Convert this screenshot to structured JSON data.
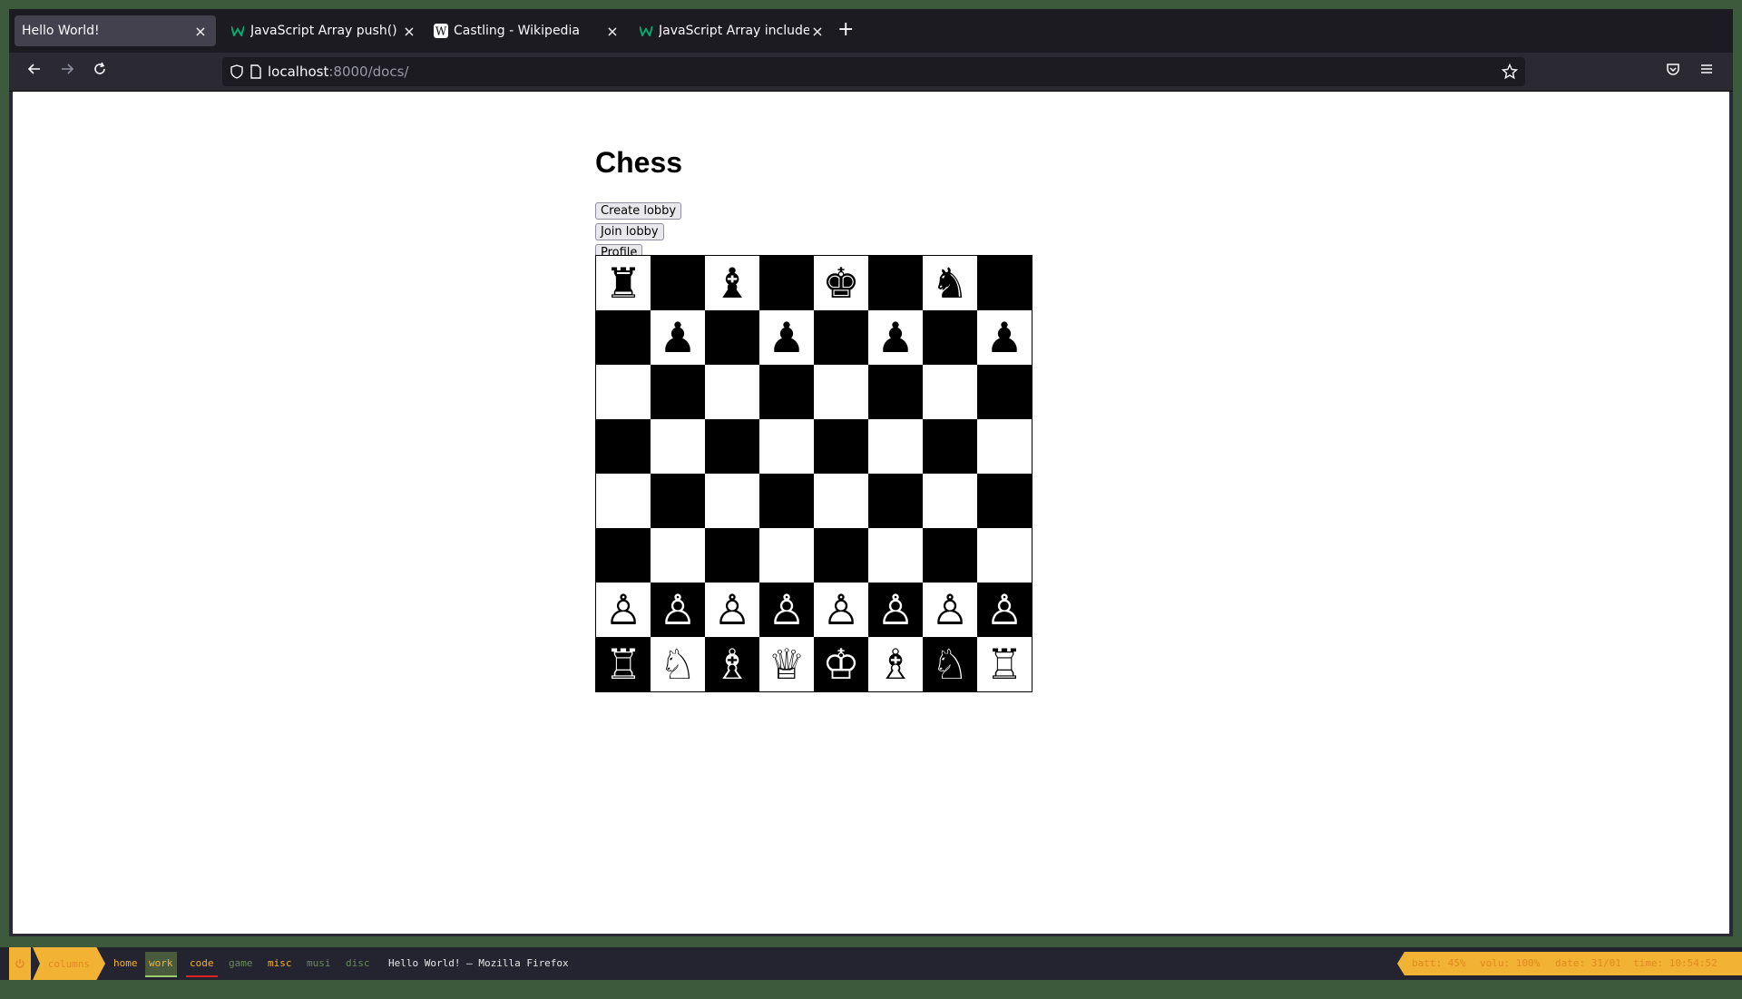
{
  "browser": {
    "tabs": [
      {
        "title": "Hello World!",
        "active": true,
        "favicon": "none"
      },
      {
        "title": "JavaScript Array push() M",
        "active": false,
        "favicon": "w3-icon"
      },
      {
        "title": "Castling - Wikipedia",
        "active": false,
        "favicon": "wikipedia-icon"
      },
      {
        "title": "JavaScript Array includes",
        "active": false,
        "favicon": "w3-icon"
      }
    ],
    "close_glyph": "×",
    "newtab_glyph": "+",
    "url_host": "localhost",
    "url_path": ":8000/docs/"
  },
  "page": {
    "title": "Chess",
    "buttons": {
      "create": "Create lobby",
      "join": "Join lobby",
      "profile": "Profile"
    },
    "board": [
      [
        "♜",
        "",
        "♝",
        "",
        "♚",
        "",
        "♞",
        ""
      ],
      [
        "",
        "♟",
        "",
        "♟",
        "",
        "♟",
        "",
        "♟"
      ],
      [
        "",
        "",
        "",
        "",
        "",
        "",
        "",
        ""
      ],
      [
        "",
        "",
        "",
        "",
        "",
        "",
        "",
        ""
      ],
      [
        "",
        "",
        "",
        "",
        "",
        "",
        "",
        ""
      ],
      [
        "",
        "",
        "",
        "",
        "",
        "",
        "",
        ""
      ],
      [
        "♙",
        "♙",
        "♙",
        "♙",
        "♙",
        "♙",
        "♙",
        "♙"
      ],
      [
        "♖",
        "♘",
        "♗",
        "♕",
        "♔",
        "♗",
        "♘",
        "♖"
      ]
    ]
  },
  "statusbar": {
    "layout": "columns",
    "workspaces": [
      "home",
      "work",
      "code",
      "game",
      "misc",
      "musi",
      "disc"
    ],
    "window_title": "Hello World! — Mozilla Firefox",
    "battery": "batt: 45%",
    "volume": "volu: 100%",
    "date": "date: 31/01",
    "time": "time: 10:54:52 am"
  }
}
